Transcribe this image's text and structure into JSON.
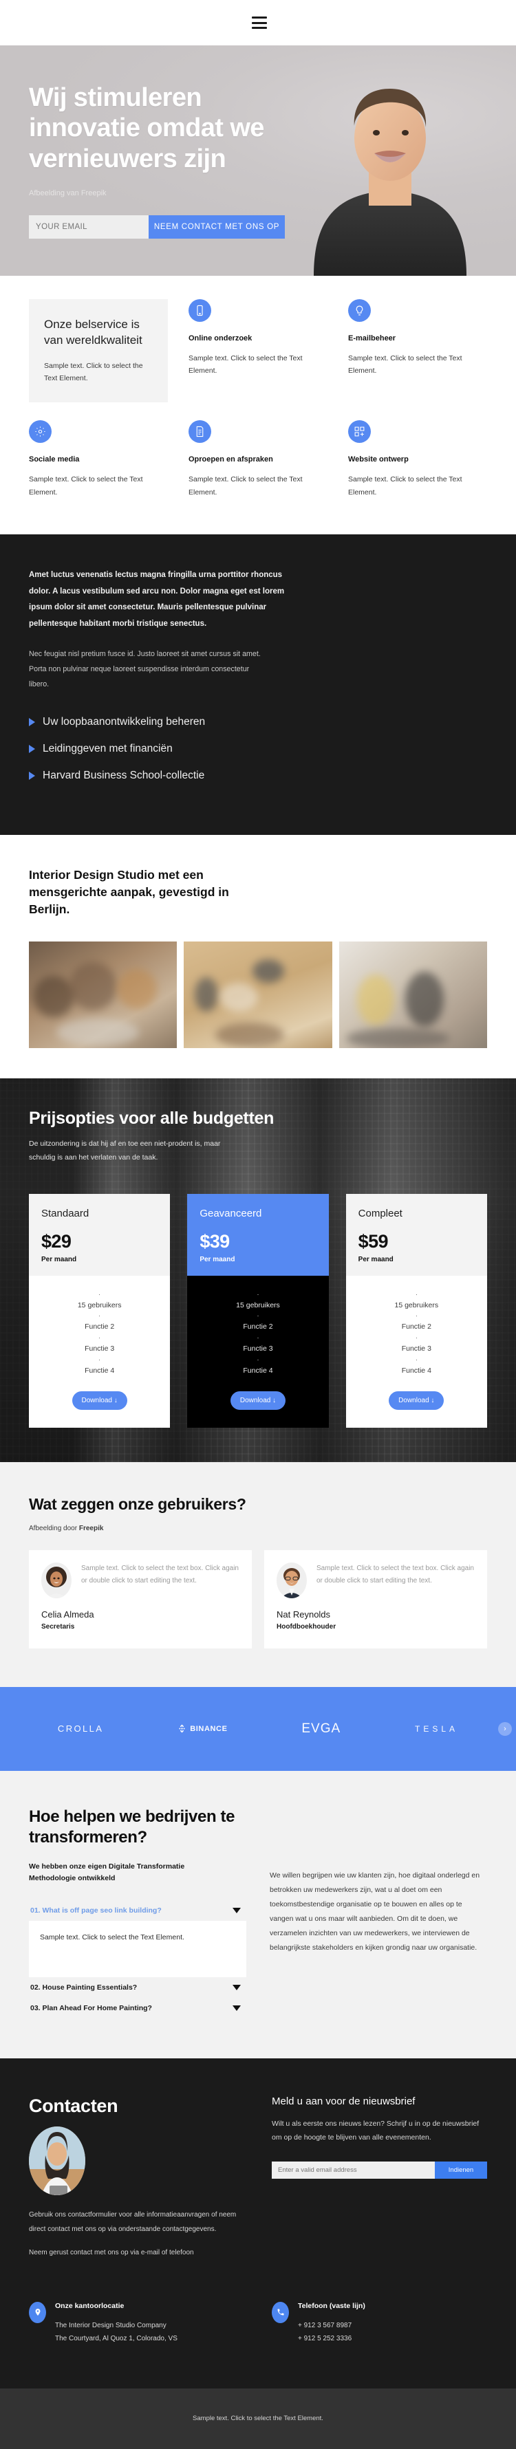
{
  "header": {
    "menu_label": "menu"
  },
  "hero": {
    "title": "Wij stimuleren innovatie omdat we vernieuwers zijn",
    "credit": "Afbeelding van Freepik",
    "email_placeholder": "YOUR EMAIL",
    "email_value": "",
    "cta": "NEEM CONTACT MET ONS OP"
  },
  "features": {
    "intro": {
      "title": "Onze belservice is van wereldkwaliteit",
      "body": "Sample text. Click to select the Text Element."
    },
    "items": [
      {
        "icon": "mobile-icon",
        "title": "Online onderzoek",
        "body": "Sample text. Click to select the Text Element."
      },
      {
        "icon": "lightbulb-icon",
        "title": "E-mailbeheer",
        "body": "Sample text. Click to select the Text Element."
      },
      {
        "icon": "gear-icon",
        "title": "Sociale media",
        "body": "Sample text. Click to select the Text Element."
      },
      {
        "icon": "checklist-icon",
        "title": "Oproepen en afspraken",
        "body": "Sample text. Click to select the Text Element."
      },
      {
        "icon": "grid-plus-icon",
        "title": "Website ontwerp",
        "body": "Sample text. Click to select the Text Element."
      }
    ]
  },
  "dark_block": {
    "lead": "Amet luctus venenatis lectus magna fringilla urna porttitor rhoncus dolor. A lacus vestibulum sed arcu non. Dolor magna eget est lorem ipsum dolor sit amet consectetur. Mauris pellentesque pulvinar pellentesque habitant morbi tristique senectus.",
    "sub": "Nec feugiat nisl pretium fusce id. Justo laoreet sit amet cursus sit amet. Porta non pulvinar neque laoreet suspendisse interdum consectetur libero.",
    "bullets": [
      "Uw loopbaanontwikkeling beheren",
      "Leidinggeven met financiën",
      "Harvard Business School-collectie"
    ]
  },
  "studio": {
    "heading": "Interior Design Studio met een mensgerichte aanpak, gevestigd in Berlijn.",
    "gallery": [
      "team-meeting-laptop-photo",
      "desk-notebook-laptop-photo",
      "two-women-talking-photo"
    ]
  },
  "pricing": {
    "title": "Prijsopties voor alle budgetten",
    "subtitle": "De uitzondering is dat hij af en toe een niet-prodent is, maar schuldig is aan het verlaten van de taak.",
    "plans": [
      {
        "name": "Standaard",
        "price": "$29",
        "per": "Per maand",
        "features": [
          "15 gebruikers",
          "Functie 2",
          "Functie 3",
          "Functie 4"
        ],
        "button": "Download ↓",
        "featured": false
      },
      {
        "name": "Geavanceerd",
        "price": "$39",
        "per": "Per maand",
        "features": [
          "15 gebruikers",
          "Functie 2",
          "Functie 3",
          "Functie 4"
        ],
        "button": "Download ↓",
        "featured": true
      },
      {
        "name": "Compleet",
        "price": "$59",
        "per": "Per maand",
        "features": [
          "15 gebruikers",
          "Functie 2",
          "Functie 3",
          "Functie 4"
        ],
        "button": "Download ↓",
        "featured": false
      }
    ]
  },
  "testimonials": {
    "title": "Wat zeggen onze gebruikers?",
    "credit_prefix": "Afbeelding door ",
    "credit_brand": "Freepik",
    "items": [
      {
        "quote": "Sample text. Click to select the text box. Click again or double click to start editing the text.",
        "name": "Celia Almeda",
        "role": "Secretaris",
        "avatar": "woman-curly-hair-avatar"
      },
      {
        "quote": "Sample text. Click to select the text box. Click again or double click to start editing the text.",
        "name": "Nat Reynolds",
        "role": "Hoofdboekhouder",
        "avatar": "man-glasses-avatar"
      }
    ]
  },
  "logos": {
    "items": [
      "CROLLA",
      "BINANCE",
      "EVGA",
      "TESLA"
    ],
    "next_label": "›"
  },
  "faq": {
    "title": "Hoe helpen we bedrijven te transformeren?",
    "subtitle": "We hebben onze eigen Digitale Transformatie Methodologie ontwikkeld",
    "right_text": "We willen begrijpen wie uw klanten zijn, hoe digitaal onderlegd en betrokken uw medewerkers zijn, wat u al doet om een toekomstbestendige organisatie op te bouwen en alles op te vangen wat u ons maar wilt aanbieden. Om dit te doen, we verzamelen inzichten van uw medewerkers, we interviewen de belangrijkste stakeholders en kijken grondig naar uw organisatie.",
    "items": [
      {
        "title": "01. What is off page seo link building?",
        "open": true,
        "body": "Sample text. Click to select the Text Element."
      },
      {
        "title": "02. House Painting Essentials?",
        "open": false,
        "body": ""
      },
      {
        "title": "03. Plan Ahead For Home Painting?",
        "open": false,
        "body": ""
      }
    ]
  },
  "contact": {
    "title": "Contacten",
    "avatar": "woman-at-laptop-photo",
    "body": "Gebruik ons contactformulier voor alle informatieaanvragen of neem direct contact met ons op via onderstaande contactgegevens.",
    "body2": "Neem gerust contact met ons op via e-mail of telefoon",
    "newsletter": {
      "heading": "Meld u aan voor de nieuwsbrief",
      "text": "Wilt u als eerste ons nieuws lezen? Schrijf u in op de nieuwsbrief om op de hoogte te blijven van alle evenementen.",
      "placeholder": "Enter a valid email address",
      "value": "",
      "button": "Indienen"
    },
    "office": {
      "icon": "location-pin-icon",
      "heading": "Onze kantoorlocatie",
      "lines": [
        "The Interior Design Studio Company",
        "The Courtyard, Al Quoz 1, Colorado,  VS"
      ]
    },
    "phone": {
      "icon": "phone-icon",
      "heading": "Telefoon (vaste lijn)",
      "lines": [
        "+ 912 3 567 8987",
        "+ 912 5 252 3336"
      ]
    }
  },
  "footer": {
    "text": "Sample text. Click to select the Text Element."
  },
  "colors": {
    "accent": "#5689f2",
    "dark": "#1b1b1b",
    "light": "#f2f2f2"
  }
}
